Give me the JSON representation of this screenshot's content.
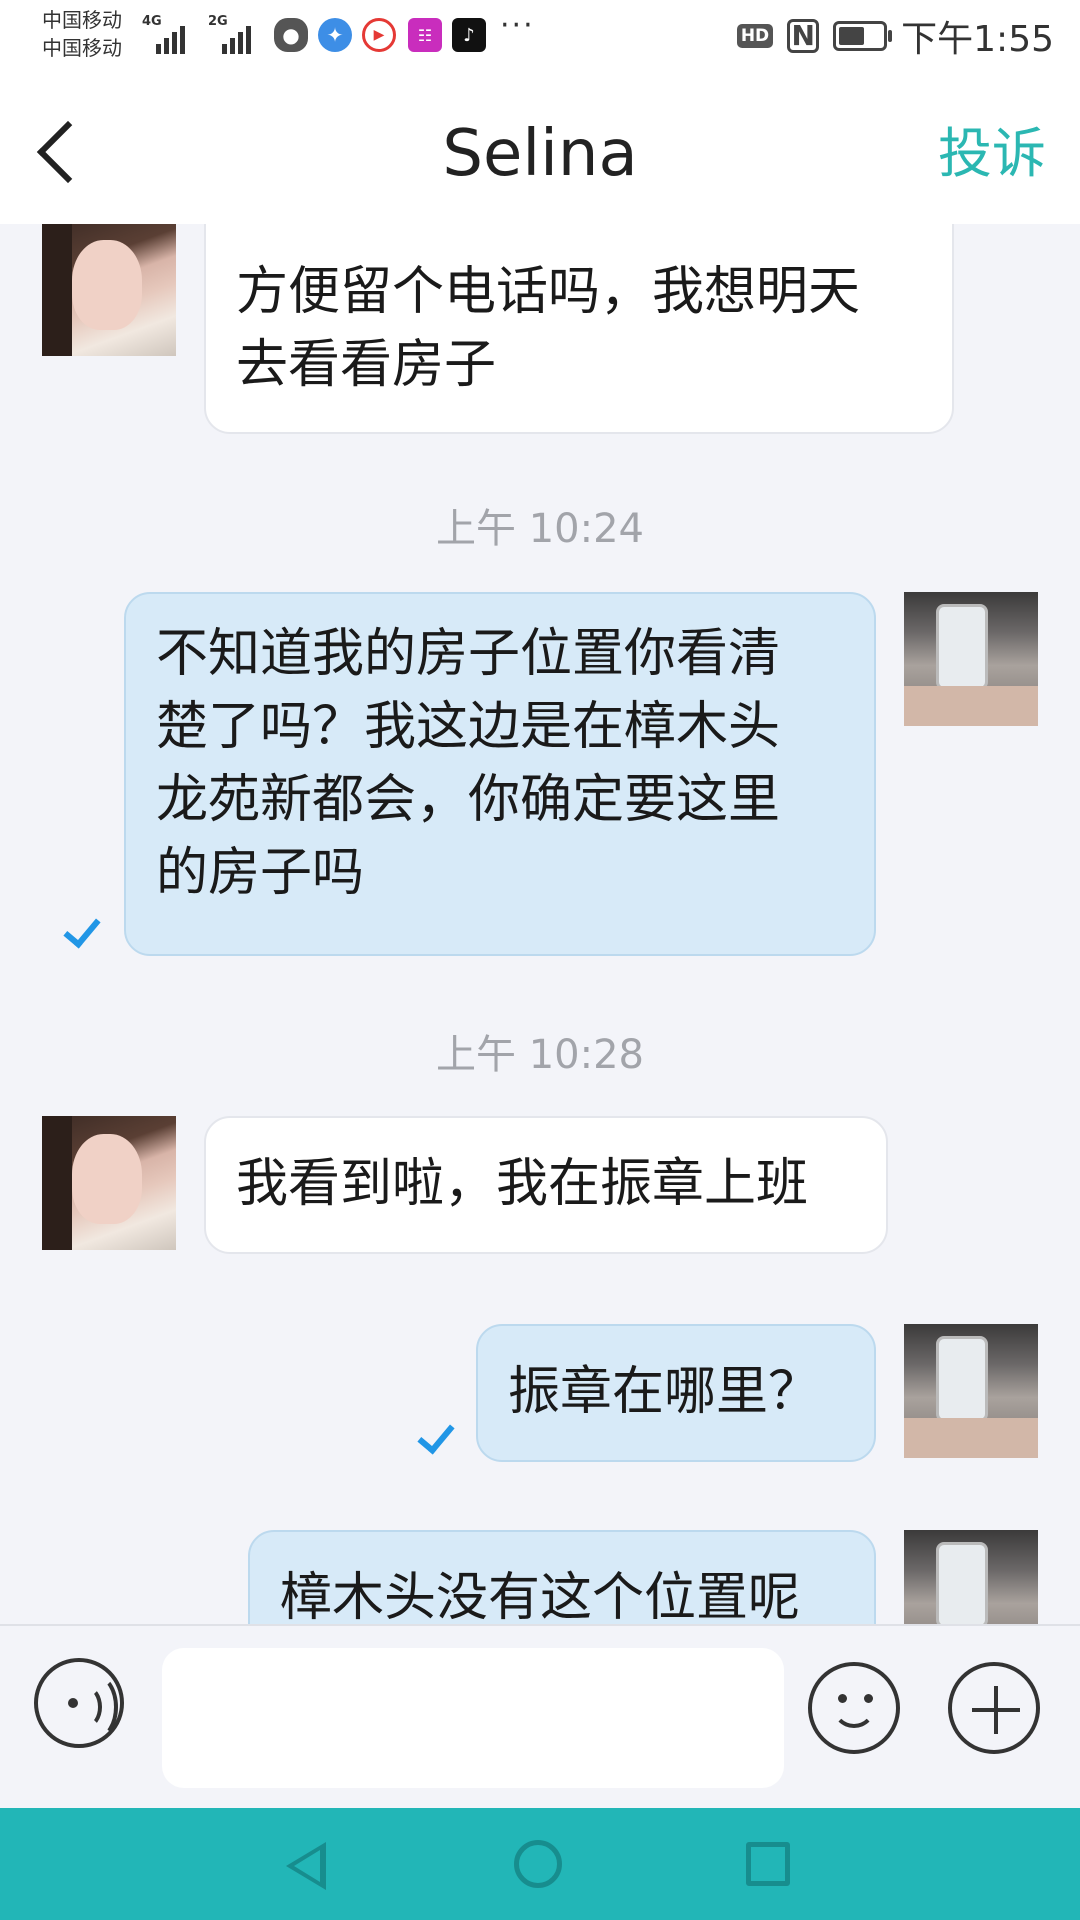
{
  "status_bar": {
    "carrier_1": "中国移动",
    "carrier_2": "中国移动",
    "network_1": "4G",
    "network_2": "2G",
    "app_icons": [
      "wechat-icon",
      "browser-icon",
      "video-app-icon",
      "ai-app-icon",
      "tiktok-icon"
    ],
    "more": "···",
    "hd": "HD",
    "nfc": "N",
    "battery_level": 0.6,
    "clock": "下午1:55"
  },
  "header": {
    "title": "Selina",
    "action": "投诉"
  },
  "messages": [
    {
      "side": "in",
      "text_lines": [
        "方便留个电话吗，我想明天",
        "去看看房子"
      ]
    },
    {
      "side": "time",
      "text": "上午 10:24"
    },
    {
      "side": "out",
      "text_lines": [
        "不知道我的房子位置你看清",
        "楚了吗？我这边是在樟木头",
        "龙苑新都会，你确定要这里",
        "的房子吗"
      ],
      "read": true
    },
    {
      "side": "time",
      "text": "上午 10:28"
    },
    {
      "side": "in",
      "text_lines": [
        "我看到啦，我在振章上班"
      ]
    },
    {
      "side": "out",
      "text_lines": [
        "振章在哪里？"
      ],
      "read": true
    },
    {
      "side": "out",
      "text_lines": [
        "樟木头没有这个位置呢"
      ]
    }
  ],
  "input": {
    "value": "",
    "placeholder": ""
  },
  "colors": {
    "accent": "#2bb7b2",
    "outgoing_bubble": "#d7eaf8",
    "incoming_bubble": "#ffffff",
    "read_check": "#2196e6",
    "nav_bar": "#22b6b7"
  }
}
